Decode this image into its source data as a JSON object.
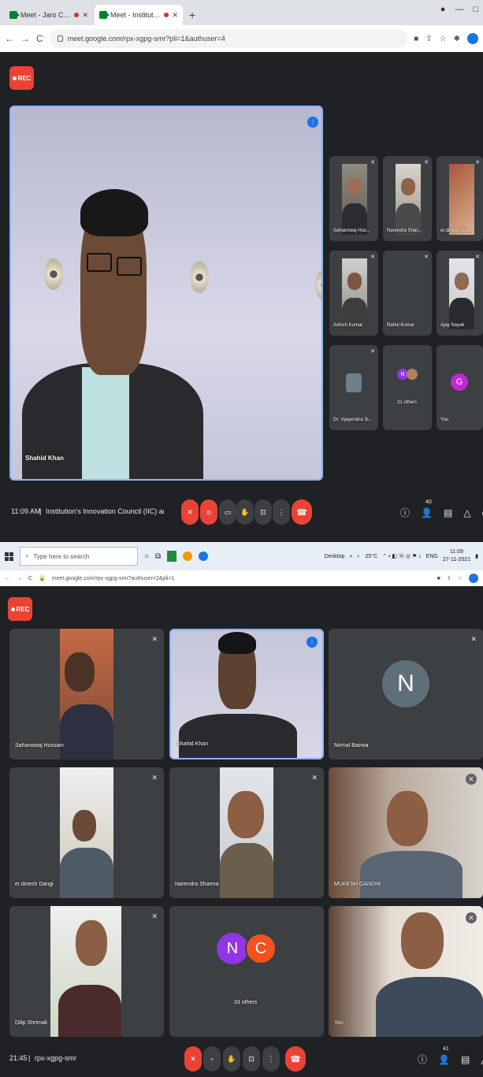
{
  "browser_top": {
    "tabs": [
      {
        "title": "Meet - Jaro Campus Placem"
      },
      {
        "title": "Meet - Institution's Innovati"
      }
    ],
    "new_tab": "+",
    "url": "meet.google.com/rpx-xgpg-smr?pli=1&authuser=4"
  },
  "meet_top": {
    "rec_label": "REC",
    "main_speaker": "Shahid Khan",
    "side_tiles": [
      {
        "name": "Sahanowaj Hus..."
      },
      {
        "name": "Narendra Shar..."
      },
      {
        "name": "er.dinesh Dan..."
      },
      {
        "name": "Ashish Kumar"
      },
      {
        "name": "Rahul Kumar"
      },
      {
        "name": "Ajay Nayak"
      },
      {
        "name": "Dr. Vijayendra Si..."
      },
      {
        "name": "31 others",
        "avatar_letter": "N"
      },
      {
        "name": "You",
        "avatar_letter": "G"
      }
    ],
    "time": "11:09 AM",
    "separator": "|",
    "meeting_title": "Institution's Innovation Council (IIC) and Dep...",
    "participant_count": "40"
  },
  "taskbar": {
    "search_placeholder": "Type here to search",
    "desktop_label": "Desktop",
    "weather": "25°C",
    "lang": "ENG",
    "clock_time": "11:09",
    "clock_date": "27-11-2021"
  },
  "browser_bottom": {
    "url": "meet.google.com/rpx-xgpg-smr?authuser=2&pli=1"
  },
  "meet_bottom": {
    "rec_label": "REC",
    "tiles": [
      {
        "name": "Sahanowaj Hussain"
      },
      {
        "name": "Shahid Khan"
      },
      {
        "name": "Nirmal Bairwa",
        "avatar_letter": "N"
      },
      {
        "name": "er.dinesh Dangi"
      },
      {
        "name": "Narendra Sharma"
      },
      {
        "name": "MUKESH GANDHI"
      },
      {
        "name": "Dilip Shrimali"
      },
      {
        "name": "33 others",
        "avatar_letters": [
          "N",
          "C"
        ]
      },
      {
        "name": "You"
      }
    ],
    "time": "21:45",
    "separator": "|",
    "meeting_code": "rpx-xgpg-smr",
    "participant_count": "41"
  },
  "colors": {
    "meet_bg": "#202124",
    "tile_bg": "#3c4043",
    "accent_red": "#ea4335",
    "speaker_border": "#8ab4f8",
    "avatar_purple": "#9334e6",
    "avatar_orange": "#f4511e",
    "avatar_grey": "#5f6f7a",
    "avatar_pink": "#c026d3"
  }
}
